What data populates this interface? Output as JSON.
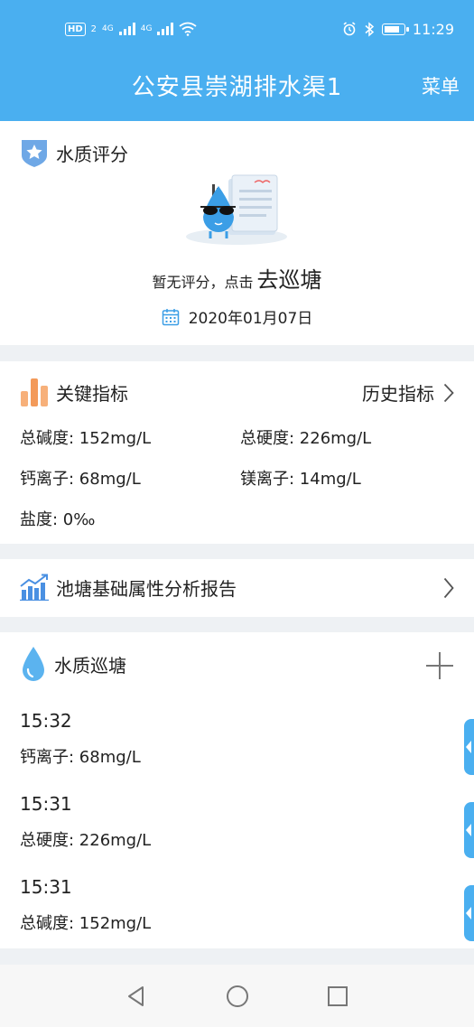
{
  "status_bar": {
    "hd": "HD",
    "sim": "2",
    "net1": "4G",
    "net2": "4G",
    "time": "11:29",
    "battery_level": 0.85
  },
  "header": {
    "title": "公安县崇湖排水渠1",
    "menu_label": "菜单"
  },
  "water_score": {
    "title": "水质评分",
    "no_score_text": "暂无评分，点击",
    "go_patrol_label": "去巡塘",
    "date": "2020年01月07日"
  },
  "key_indicators": {
    "title": "关键指标",
    "history_label": "历史指标",
    "metrics": [
      "总碱度: 152mg/L",
      "总硬度: 226mg/L",
      "钙离子: 68mg/L",
      "镁离子: 14mg/L",
      "盐度: 0‰"
    ]
  },
  "report": {
    "title": "池塘基础属性分析报告"
  },
  "patrol": {
    "title": "水质巡塘",
    "entries": [
      {
        "time": "15:32",
        "value": "钙离子: 68mg/L"
      },
      {
        "time": "15:31",
        "value": "总硬度: 226mg/L"
      },
      {
        "time": "15:31",
        "value": "总碱度: 152mg/L"
      }
    ]
  },
  "colors": {
    "primary": "#4aaff0",
    "background": "#eef1f4",
    "accent_orange": "#f39a5a"
  }
}
